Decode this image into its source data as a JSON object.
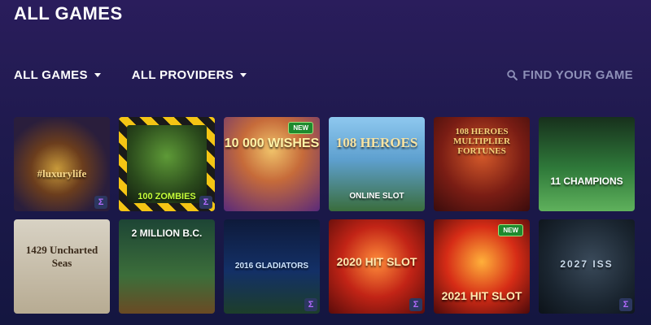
{
  "header": {
    "title": "ALL GAMES"
  },
  "filters": [
    {
      "label": "ALL GAMES"
    },
    {
      "label": "ALL PROVIDERS"
    }
  ],
  "search": {
    "placeholder": "FIND YOUR GAME"
  },
  "games": [
    {
      "title": "#luxurylife",
      "badge": ""
    },
    {
      "title": "100 ZOMBIES",
      "badge": ""
    },
    {
      "title": "10 000 WISHES",
      "badge": "NEW"
    },
    {
      "title": "108 HEROES",
      "subtitle": "ONLINE SLOT",
      "badge": ""
    },
    {
      "title": "108 HEROES MULTIPLIER FORTUNES",
      "badge": ""
    },
    {
      "title": "11 CHAMPIONS",
      "badge": ""
    },
    {
      "title": "1429 Uncharted Seas",
      "badge": ""
    },
    {
      "title": "2 MILLION B.C.",
      "badge": ""
    },
    {
      "title": "2016 GLADIATORS",
      "badge": ""
    },
    {
      "title": "2020 HIT SLOT",
      "badge": ""
    },
    {
      "title": "2021 HIT SLOT",
      "badge": "NEW"
    },
    {
      "title": "2027 ISS",
      "badge": ""
    }
  ],
  "colors": {
    "background": "#1f1a4e",
    "search_text": "#8e90b8",
    "new_badge": "#1e8a2e"
  }
}
